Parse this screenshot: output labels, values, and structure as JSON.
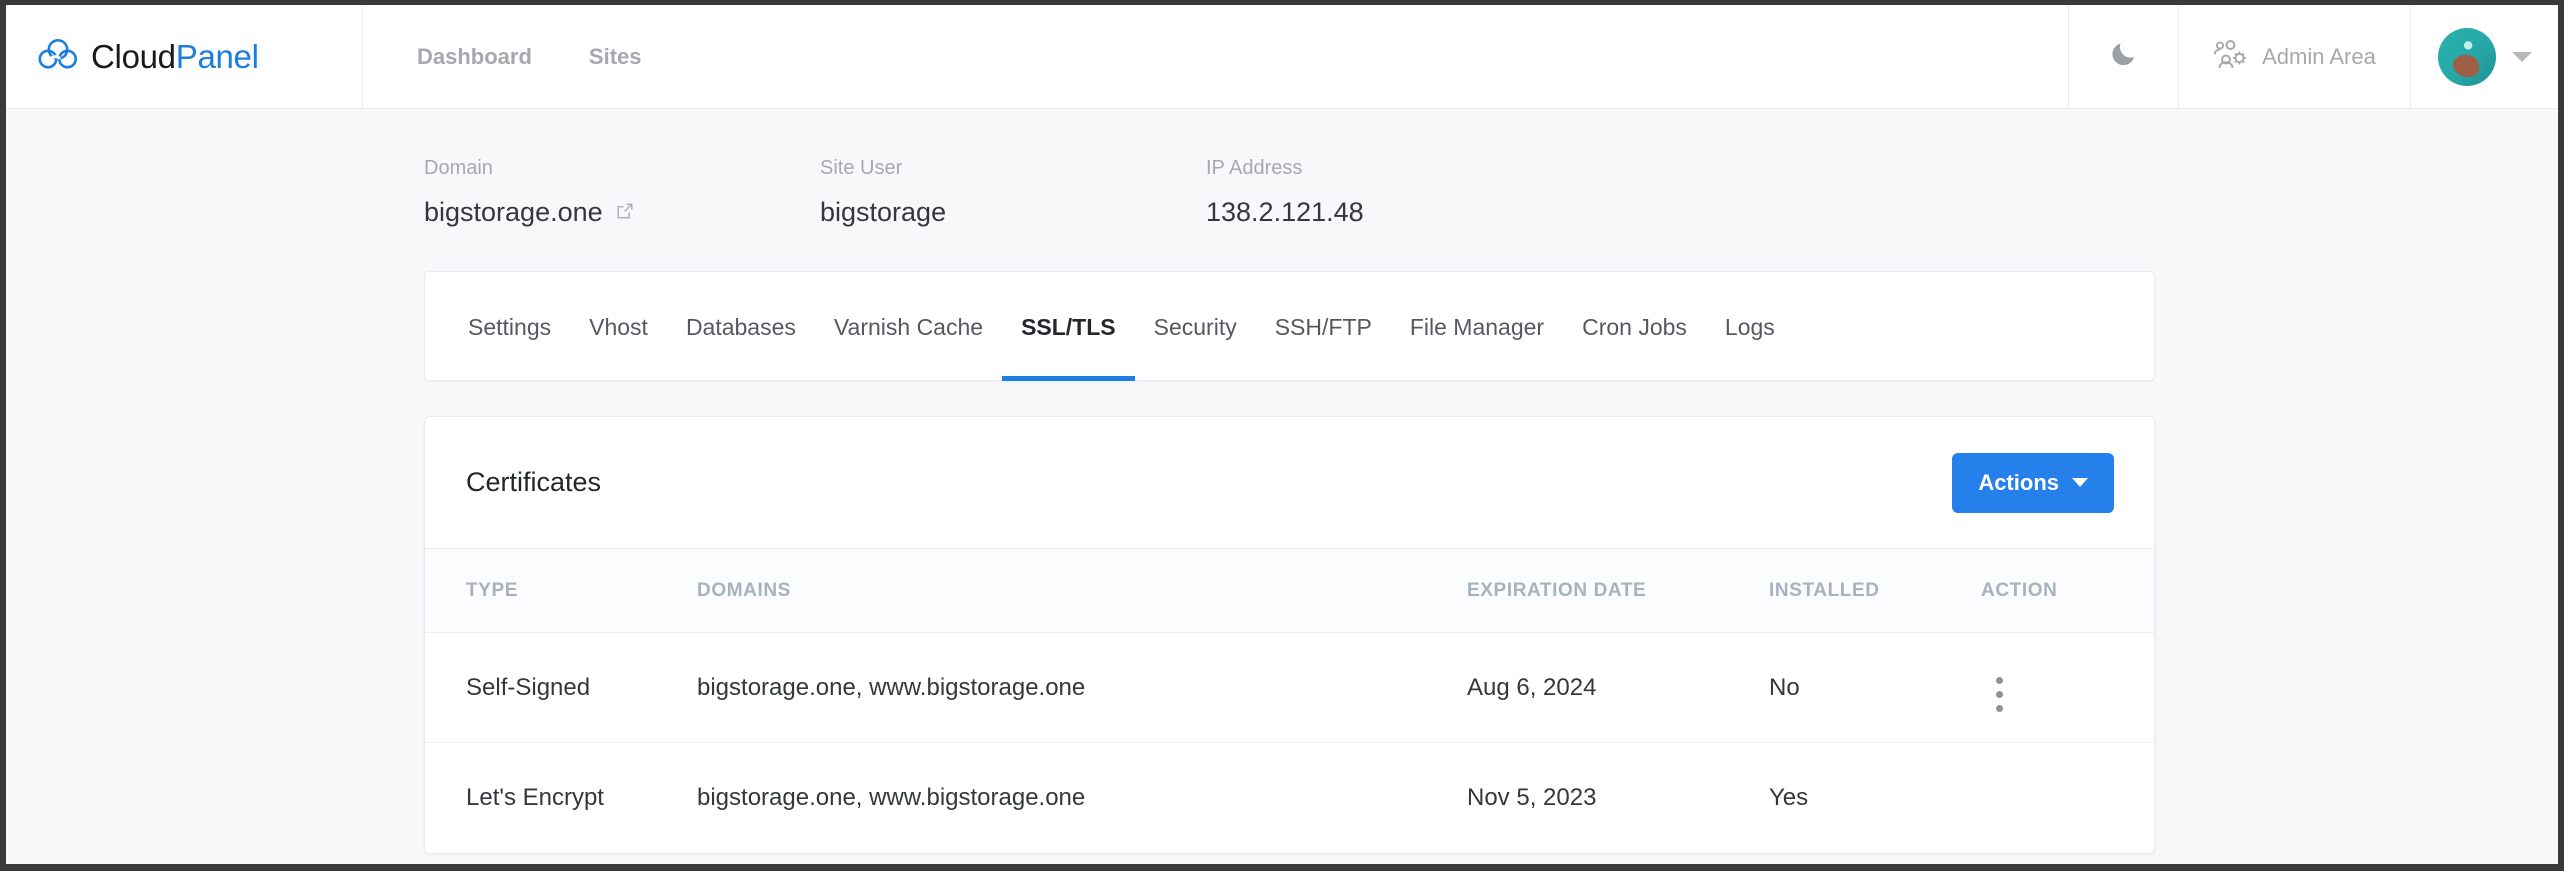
{
  "header": {
    "brand": {
      "part1": "Cloud",
      "part2": "Panel",
      "logo_icon": "cloud-logo-icon"
    },
    "nav": [
      {
        "label": "Dashboard",
        "name": "nav-dashboard"
      },
      {
        "label": "Sites",
        "name": "nav-sites"
      }
    ],
    "dark_mode_icon": "moon-icon",
    "admin": {
      "label": "Admin Area",
      "icon": "users-gear-icon"
    },
    "user": {
      "avatar_icon": "user-avatar",
      "caret_icon": "chevron-down-icon"
    }
  },
  "meta": {
    "domain": {
      "label": "Domain",
      "value": "bigstorage.one",
      "icon": "external-link-icon"
    },
    "site_user": {
      "label": "Site User",
      "value": "bigstorage"
    },
    "ip_address": {
      "label": "IP Address",
      "value": "138.2.121.48"
    }
  },
  "tabs": [
    {
      "label": "Settings",
      "active": false
    },
    {
      "label": "Vhost",
      "active": false
    },
    {
      "label": "Databases",
      "active": false
    },
    {
      "label": "Varnish Cache",
      "active": false
    },
    {
      "label": "SSL/TLS",
      "active": true
    },
    {
      "label": "Security",
      "active": false
    },
    {
      "label": "SSH/FTP",
      "active": false
    },
    {
      "label": "File Manager",
      "active": false
    },
    {
      "label": "Cron Jobs",
      "active": false
    },
    {
      "label": "Logs",
      "active": false
    }
  ],
  "card": {
    "title": "Certificates",
    "actions_button": {
      "label": "Actions",
      "icon": "caret-down-icon"
    }
  },
  "table": {
    "columns": [
      "TYPE",
      "DOMAINS",
      "EXPIRATION DATE",
      "INSTALLED",
      "ACTION"
    ],
    "rows": [
      {
        "type": "Self-Signed",
        "domains": "bigstorage.one, www.bigstorage.one",
        "expiration_date": "Aug 6, 2024",
        "installed": "No",
        "has_action": true
      },
      {
        "type": "Let's Encrypt",
        "domains": "bigstorage.one, www.bigstorage.one",
        "expiration_date": "Nov 5, 2023",
        "installed": "Yes",
        "has_action": false
      }
    ]
  },
  "colors": {
    "accent": "#2680eb",
    "brand_blue": "#1a7fe0",
    "page_bg": "#f7f8fa",
    "muted_text": "#a5a9ae"
  }
}
